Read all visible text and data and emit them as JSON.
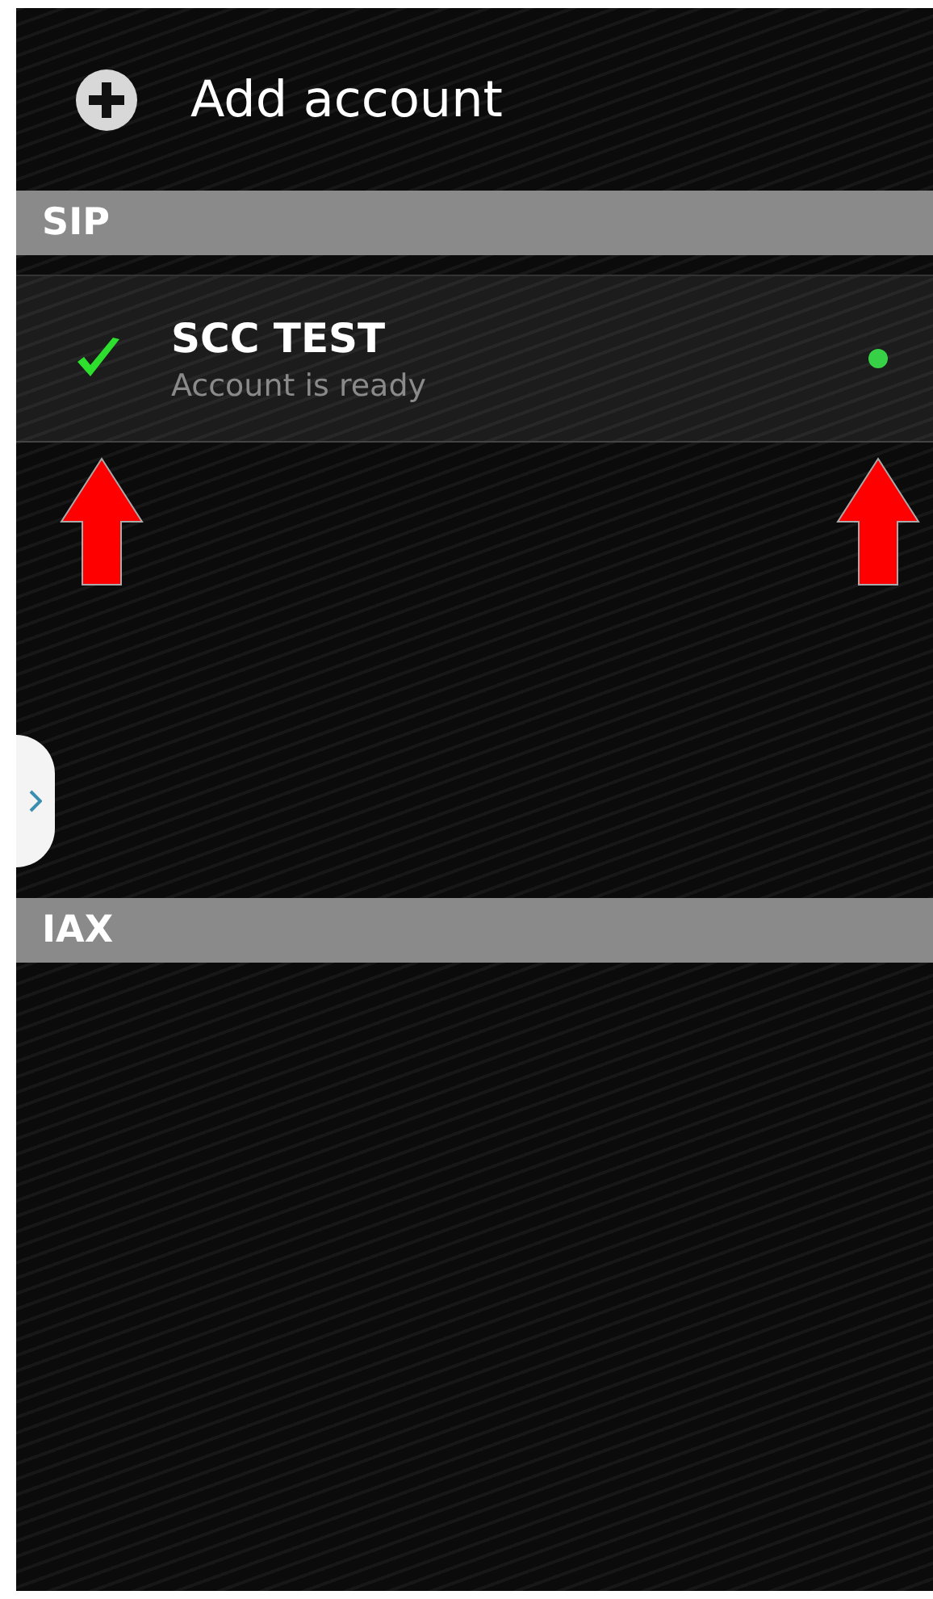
{
  "add_account": {
    "label": "Add account"
  },
  "sections": [
    {
      "title": "SIP",
      "accounts": [
        {
          "name": "SCC TEST",
          "status": "Account is ready",
          "ready": true,
          "registered": true
        }
      ]
    },
    {
      "title": "IAX"
    }
  ]
}
